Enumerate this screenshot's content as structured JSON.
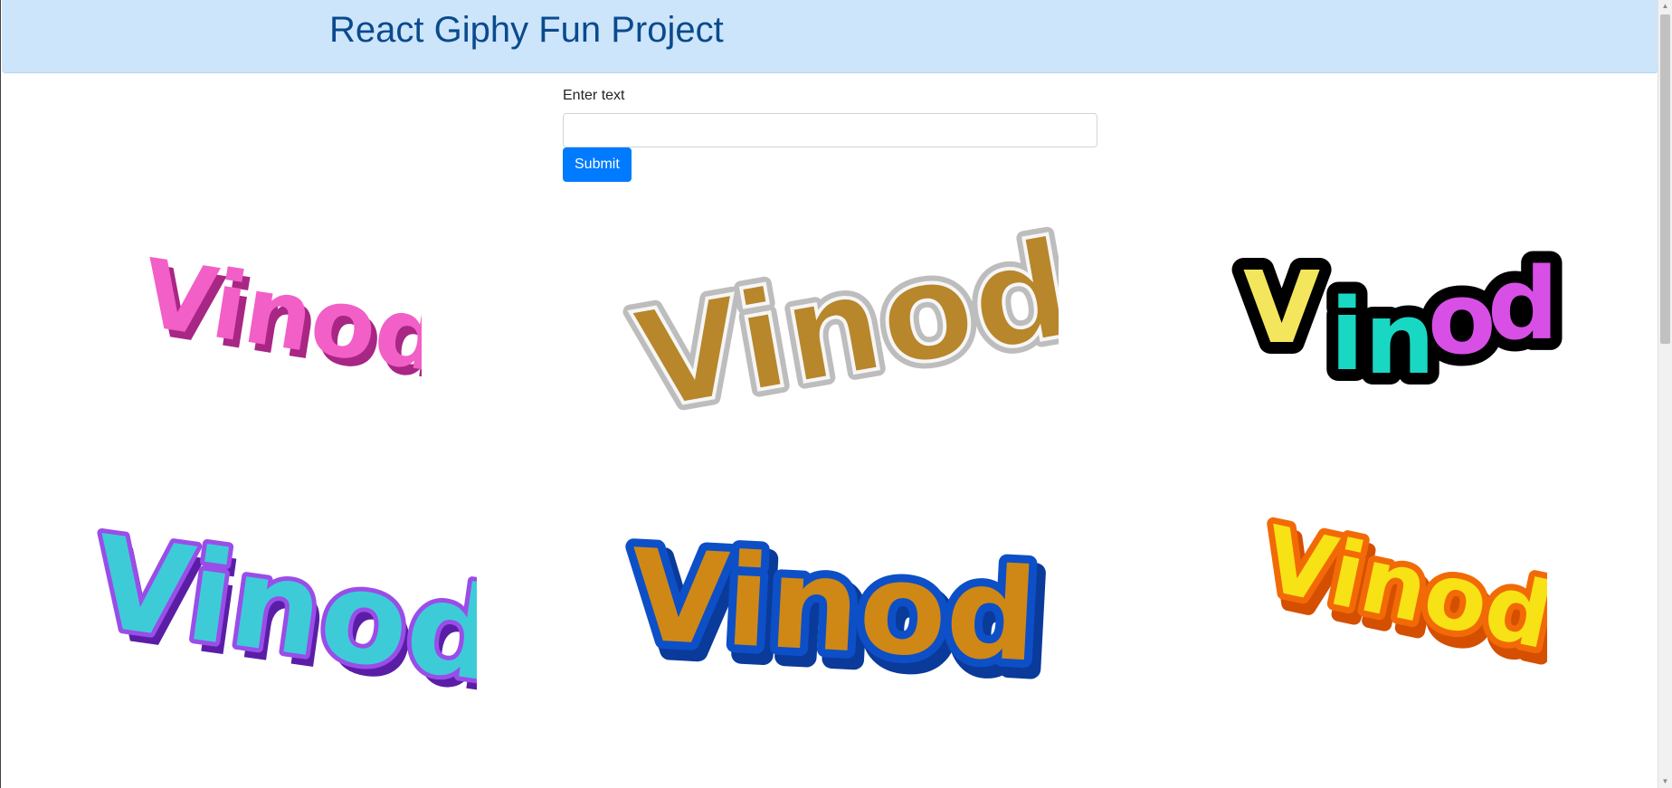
{
  "header": {
    "title": "React Giphy Fun Project"
  },
  "form": {
    "label": "Enter text",
    "value": "",
    "submit_label": "Submit"
  },
  "gifs": [
    {
      "text": "Vinod",
      "style": "pink-3d",
      "colors": [
        "#f25fc7",
        "#c9399f"
      ]
    },
    {
      "text": "Vinod",
      "style": "gold-glitter",
      "colors": [
        "#b8862b",
        "#e8e8e8"
      ]
    },
    {
      "text": "Vinod",
      "style": "multicolor-black-outline",
      "colors": [
        "#f4e65c",
        "#19d8c3",
        "#d84fe6",
        "#000000"
      ]
    },
    {
      "text": "Vinod",
      "style": "purple-cyan",
      "colors": [
        "#7a2ed1",
        "#3ecbd8"
      ]
    },
    {
      "text": "Vinod",
      "style": "blue-orange",
      "colors": [
        "#0d4fc7",
        "#cf8816"
      ]
    },
    {
      "text": "Vinod",
      "style": "orange-yellow",
      "colors": [
        "#f26a06",
        "#f7e215"
      ]
    }
  ]
}
